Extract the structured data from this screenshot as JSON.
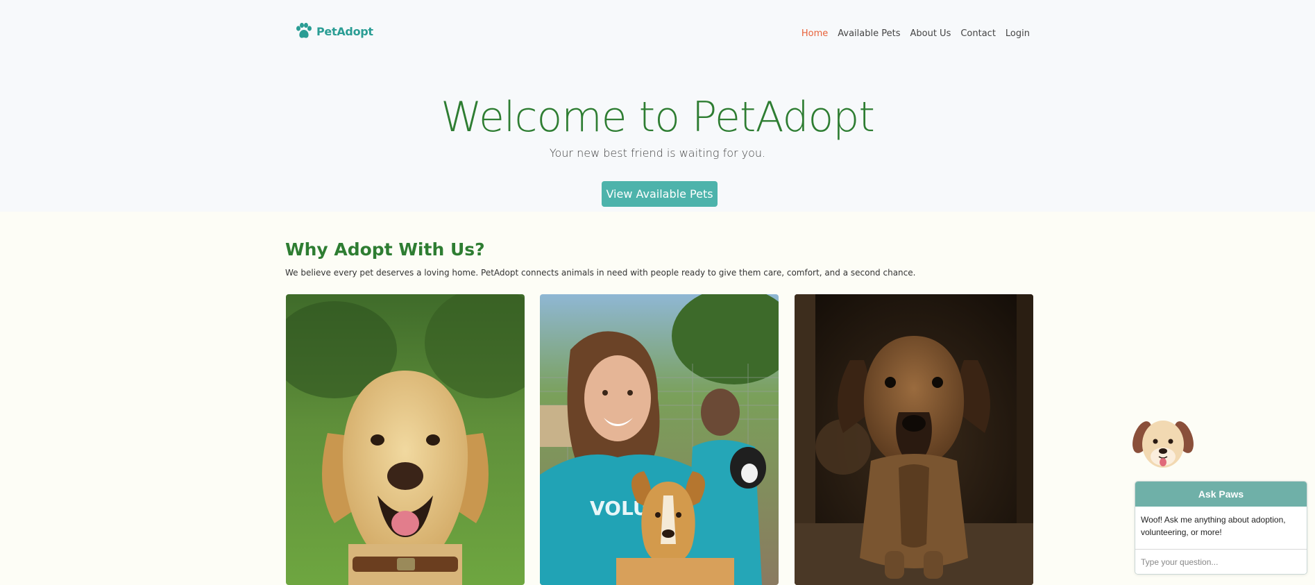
{
  "brand": {
    "name": "PetAdopt",
    "logo_icon": "paw-icon",
    "color": "#2a9d94"
  },
  "nav": {
    "items": [
      {
        "label": "Home",
        "active": true
      },
      {
        "label": "Available Pets",
        "active": false
      },
      {
        "label": "About Us",
        "active": false
      },
      {
        "label": "Contact",
        "active": false
      },
      {
        "label": "Login",
        "active": false
      }
    ]
  },
  "hero": {
    "title": "Welcome to PetAdopt",
    "subtitle": "Your new best friend is waiting for you.",
    "button_label": "View Available Pets"
  },
  "why": {
    "title": "Why Adopt With Us?",
    "text": "We believe every pet deserves a loving home. PetAdopt connects animals in need with people ready to give them care, comfort, and a second chance."
  },
  "cards": [
    {
      "image": "golden-labrador-photo"
    },
    {
      "image": "volunteers-with-dog-photo",
      "shirt_text": "VOLUNTE"
    },
    {
      "image": "puppy-photo"
    }
  ],
  "chat": {
    "mascot_icon": "dog-face-icon",
    "title": "Ask Paws",
    "message": "Woof! Ask me anything about adoption, volunteering, or more!",
    "placeholder": "Type your question..."
  },
  "colors": {
    "accent": "#4db3ab",
    "heading_green": "#2e7d32",
    "nav_active": "#e8623a",
    "chat_header": "#6fb0a8"
  }
}
